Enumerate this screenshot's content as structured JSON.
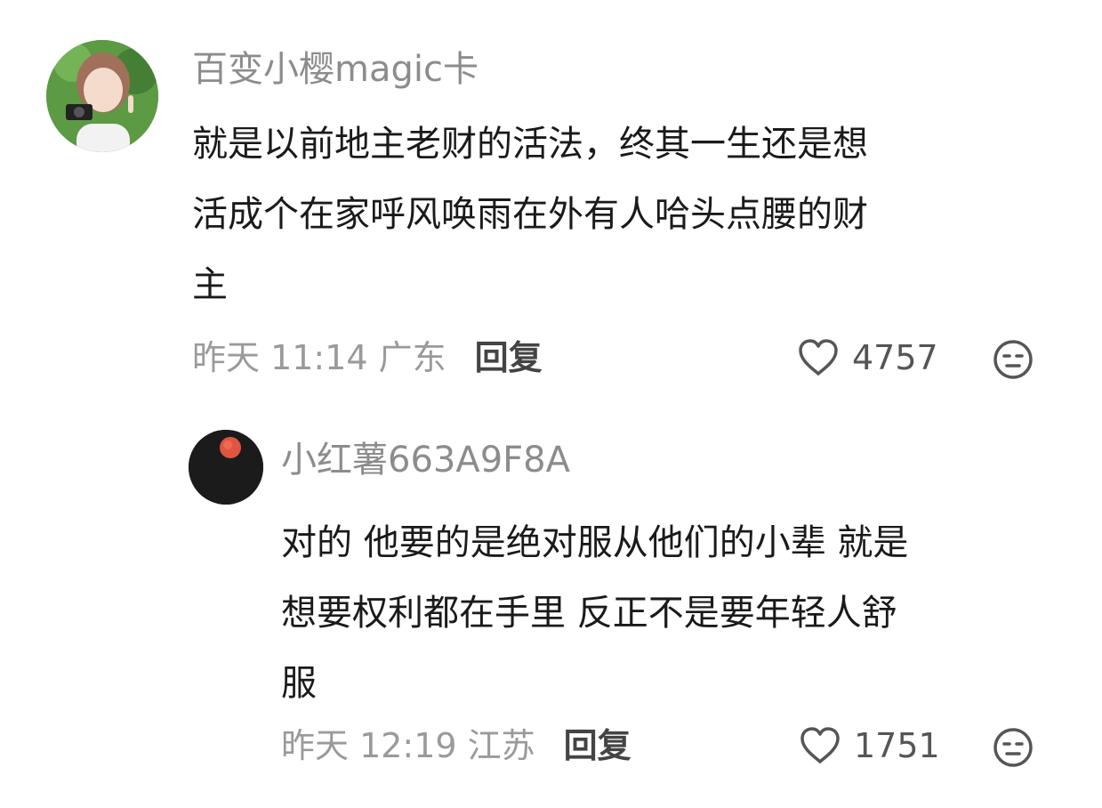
{
  "comments": [
    {
      "username": "百变小樱magic卡",
      "lines": [
        "就是以前地主老财的活法，终其一生还是想",
        "活成个在家呼风唤雨在外有人哈头点腰的财",
        "主"
      ],
      "time_location": "昨天 11:14 广东",
      "reply_label": "回复",
      "like_count": "4757",
      "avatar_icon": "user-avatar-photo"
    },
    {
      "username": "小红薯663A9F8A",
      "lines": [
        "对的 他要的是绝对服从他们的小辈 就是",
        "想要权利都在手里 反正不是要年轻人舒",
        "服"
      ],
      "time_location": "昨天 12:19 江苏",
      "reply_label": "回复",
      "like_count": "1751",
      "avatar_icon": "user-avatar-moon"
    }
  ],
  "icons": {
    "like": "heart-outline-icon",
    "reaction": "emoji-face-icon"
  },
  "colors": {
    "username": "#8c8c8c",
    "text": "#1a1a1a",
    "meta": "#9a9a9a",
    "reply": "#444444"
  }
}
